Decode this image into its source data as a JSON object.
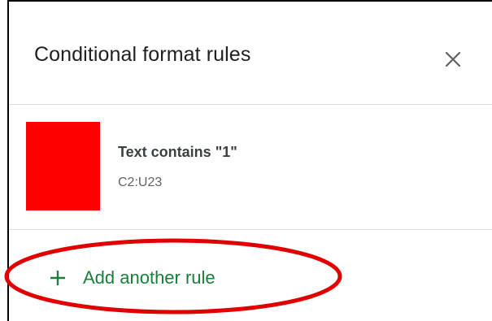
{
  "panel": {
    "title": "Conditional format rules",
    "close_icon": "close-icon"
  },
  "rules": [
    {
      "condition": "Text contains \"1\"",
      "range": "C2:U23",
      "swatch_color": "#ff0000"
    }
  ],
  "add_rule": {
    "label": "Add another rule",
    "icon": "plus-icon",
    "color": "#188038"
  },
  "annotation": {
    "shape": "ellipse",
    "color": "#e00000"
  }
}
